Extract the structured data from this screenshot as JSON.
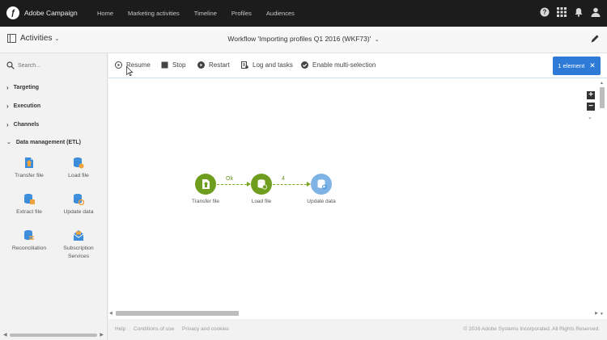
{
  "app": {
    "name": "Adobe Campaign"
  },
  "nav": {
    "items": [
      "Home",
      "Marketing activities",
      "Timeline",
      "Profiles",
      "Audiences"
    ]
  },
  "subheader": {
    "activities_label": "Activities",
    "workflow_title": "Workflow 'Importing profiles Q1 2016 (WKF73)'"
  },
  "sidebar": {
    "search_placeholder": "Search...",
    "groups": [
      "Targeting",
      "Execution",
      "Channels",
      "Data management (ETL)"
    ],
    "tiles": [
      "Transfer file",
      "Load file",
      "Extract file",
      "Update data",
      "Reconciliation",
      "Subscription Services"
    ]
  },
  "toolbar": {
    "resume": "Resume",
    "stop": "Stop",
    "restart": "Restart",
    "logs": "Log and tasks",
    "multi": "Enable multi-selection",
    "selection": "1 element"
  },
  "workflow": {
    "nodes": [
      {
        "label": "Transfer file",
        "color": "#6f9e1f"
      },
      {
        "label": "Load file",
        "color": "#6f9e1f"
      },
      {
        "label": "Update data",
        "color": "#7fb3e6"
      }
    ],
    "links": [
      "Ok",
      "4"
    ]
  },
  "footer": {
    "help": "Help",
    "terms": "Conditions of use",
    "privacy": "Privacy and cookies",
    "copyright": "© 2016 Adobe Systems Incorporated. All Rights Reserved."
  },
  "icons": {
    "brand": "adobe-campaign-logo",
    "top": [
      "help-icon",
      "apps-grid-icon",
      "bell-icon",
      "user-icon"
    ],
    "accent": "#2d7bd6",
    "tile_blue": "#3b8ddc",
    "tile_orange": "#f0a23b"
  }
}
